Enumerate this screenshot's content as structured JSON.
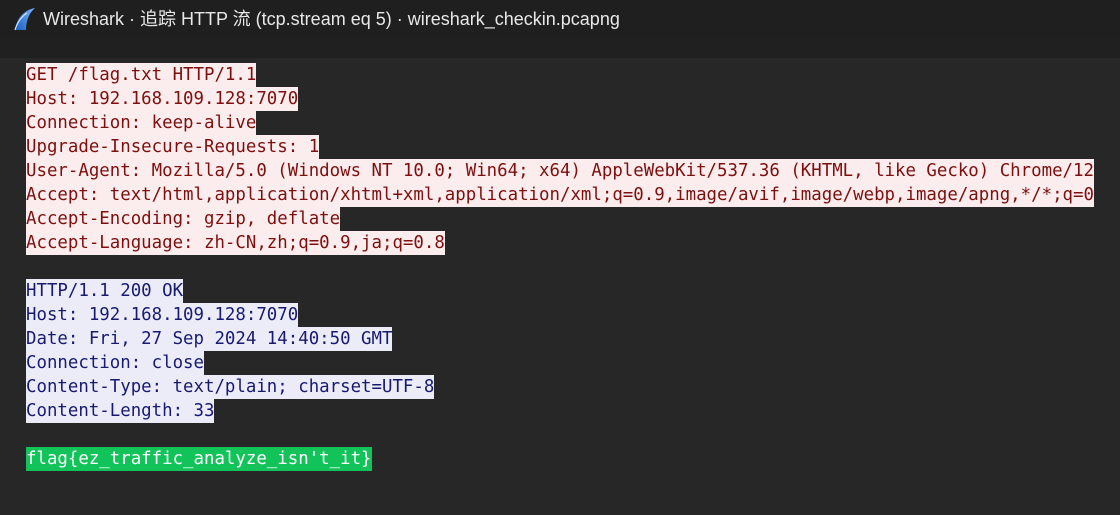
{
  "window": {
    "title": "Wireshark · 追踪 HTTP 流 (tcp.stream eq 5) · wireshark_checkin.pcapng",
    "icon": "wireshark-fin-icon"
  },
  "stream": {
    "request": [
      "GET /flag.txt HTTP/1.1",
      "Host: 192.168.109.128:7070",
      "Connection: keep-alive",
      "Upgrade-Insecure-Requests: 1",
      "User-Agent: Mozilla/5.0 (Windows NT 10.0; Win64; x64) AppleWebKit/537.36 (KHTML, like Gecko) Chrome/12",
      "Accept: text/html,application/xhtml+xml,application/xml;q=0.9,image/avif,image/webp,image/apng,*/*;q=0",
      "Accept-Encoding: gzip, deflate",
      "Accept-Language: zh-CN,zh;q=0.9,ja;q=0.8"
    ],
    "response": [
      "HTTP/1.1 200 OK",
      "Host: 192.168.109.128:7070",
      "Date: Fri, 27 Sep 2024 14:40:50 GMT",
      "Connection: close",
      "Content-Type: text/plain; charset=UTF-8",
      "Content-Length: 33"
    ],
    "body": "flag{ez_traffic_analyze_isn't_it}"
  },
  "colors": {
    "request_bg": "#fbeded",
    "request_fg": "#7d0f0f",
    "response_bg": "#ececf9",
    "response_fg": "#181a70",
    "body_bg": "#12c35a",
    "window_bg": "#202020"
  }
}
